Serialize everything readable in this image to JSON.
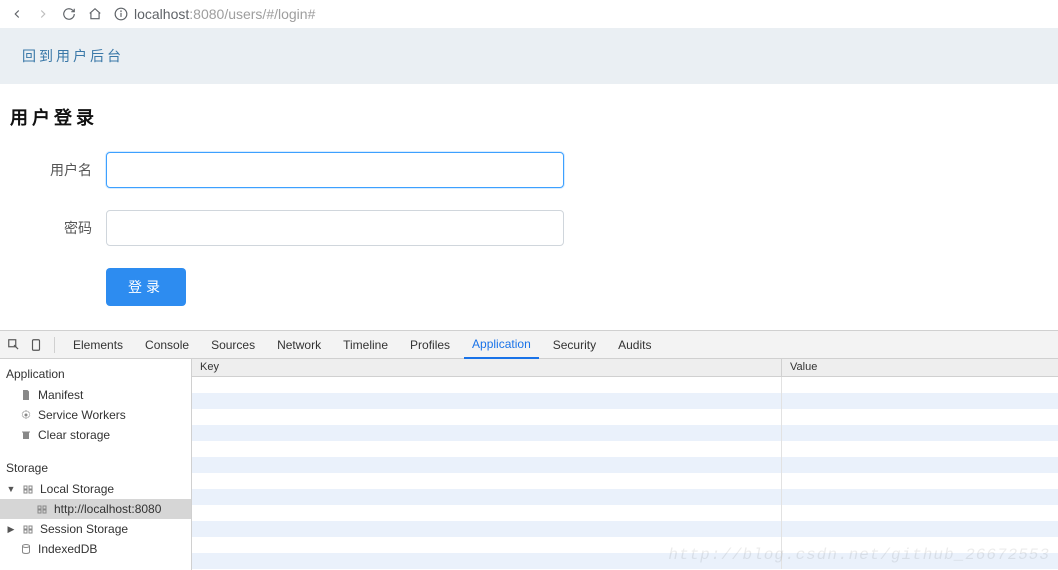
{
  "browser": {
    "url_prefix": "localhost",
    "url_port": ":8080",
    "url_path": "/users/#/login#"
  },
  "page": {
    "banner_link": "回到用户后台",
    "title": "用户登录",
    "username_label": "用户名",
    "username_value": "",
    "password_label": "密码",
    "password_value": "",
    "submit_label": "登录"
  },
  "devtools": {
    "tabs": {
      "elements": "Elements",
      "console": "Console",
      "sources": "Sources",
      "network": "Network",
      "timeline": "Timeline",
      "profiles": "Profiles",
      "application": "Application",
      "security": "Security",
      "audits": "Audits"
    },
    "sidebar": {
      "section_application": "Application",
      "manifest": "Manifest",
      "service_workers": "Service Workers",
      "clear_storage": "Clear storage",
      "section_storage": "Storage",
      "local_storage": "Local Storage",
      "local_storage_origin": "http://localhost:8080",
      "session_storage": "Session Storage",
      "indexeddb": "IndexedDB"
    },
    "table": {
      "col_key": "Key",
      "col_value": "Value"
    }
  },
  "watermark": "http://blog.csdn.net/github_26672553"
}
